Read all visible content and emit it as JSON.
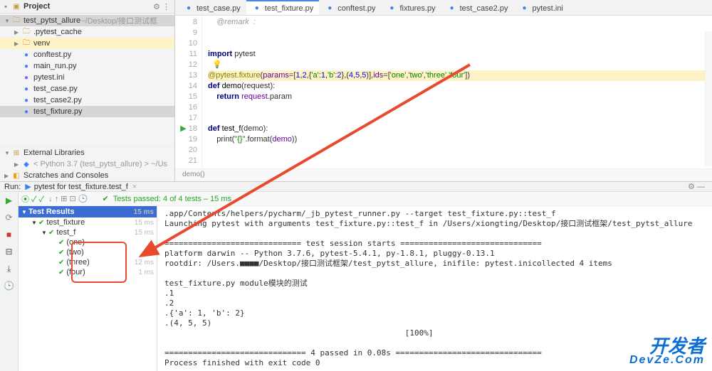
{
  "sidebar": {
    "title": "Project",
    "items": [
      {
        "icon": "folder",
        "name": "test_pytst_allure",
        "suffix": "~/Desktop/接口测试框",
        "cls": "sel",
        "indent": 0,
        "arrow": "▼"
      },
      {
        "icon": "folder",
        "name": ".pytest_cache",
        "cls": "",
        "indent": 1,
        "arrow": "▶"
      },
      {
        "icon": "venv",
        "name": "venv",
        "cls": "hi",
        "indent": 1,
        "arrow": "▶"
      },
      {
        "icon": "py",
        "name": "conftest.py",
        "cls": "",
        "indent": 1,
        "arrow": ""
      },
      {
        "icon": "py",
        "name": "main_run.py",
        "cls": "",
        "indent": 1,
        "arrow": ""
      },
      {
        "icon": "ini",
        "name": "pytest.ini",
        "cls": "",
        "indent": 1,
        "arrow": ""
      },
      {
        "icon": "py",
        "name": "test_case.py",
        "cls": "",
        "indent": 1,
        "arrow": ""
      },
      {
        "icon": "py",
        "name": "test_case2.py",
        "cls": "",
        "indent": 1,
        "arrow": ""
      },
      {
        "icon": "py",
        "name": "test_fixture.py",
        "cls": "sel",
        "indent": 1,
        "arrow": ""
      }
    ],
    "ext_lib": "External Libraries",
    "python_env": "< Python 3.7 (test_pytst_allure) >  ~/Us",
    "scratches": "Scratches and Consoles"
  },
  "tabs": [
    "test_case.py",
    "test_fixture.py",
    "conftest.py",
    "fixtures.py",
    "test_case2.py",
    "pytest.ini"
  ],
  "active_tab": 1,
  "code_start_line": 8,
  "code_lines": [
    {
      "raw": "    @remark  :",
      "parts": [
        [
          "    ",
          "pl"
        ],
        [
          "@remark  :",
          "com"
        ]
      ]
    },
    {
      "raw": "",
      "parts": []
    },
    {
      "raw": "",
      "parts": []
    },
    {
      "raw": "import pytest",
      "parts": [
        [
          "import ",
          "kw"
        ],
        [
          "pytest",
          "pl"
        ]
      ]
    },
    {
      "raw": "  💡",
      "parts": [
        [
          "  💡",
          "pl"
        ]
      ]
    },
    {
      "raw": "@pytest.fixture(params=[1,2,{'a':1,'b':2},(4,5,5)],ids=['one','two','three','four'])",
      "sel": true,
      "parts": [
        [
          "@pytest.fixture",
          "dec"
        ],
        [
          "(",
          "pl"
        ],
        [
          "params",
          "id"
        ],
        [
          "=[",
          "pl"
        ],
        [
          "1",
          "num"
        ],
        [
          ",",
          "pl"
        ],
        [
          "2",
          "num"
        ],
        [
          ",{",
          "pl"
        ],
        [
          "'a'",
          "str"
        ],
        [
          ":",
          "pl"
        ],
        [
          "1",
          "num"
        ],
        [
          ",",
          "pl"
        ],
        [
          "'b'",
          "str"
        ],
        [
          ":",
          "pl"
        ],
        [
          "2",
          "num"
        ],
        [
          "},(",
          "pl"
        ],
        [
          "4",
          "num"
        ],
        [
          ",",
          "pl"
        ],
        [
          "5",
          "num"
        ],
        [
          ",",
          "pl"
        ],
        [
          "5",
          "num"
        ],
        [
          ")],",
          "pl"
        ],
        [
          "ids",
          "id"
        ],
        [
          "=[",
          "pl"
        ],
        [
          "'one'",
          "str"
        ],
        [
          ",",
          "pl"
        ],
        [
          "'two'",
          "str"
        ],
        [
          ",",
          "pl"
        ],
        [
          "'three'",
          "str"
        ],
        [
          ",",
          "pl"
        ],
        [
          "'four'",
          "str"
        ],
        [
          "])",
          "pl"
        ]
      ]
    },
    {
      "raw": "def demo(request):",
      "parts": [
        [
          "def ",
          "kw"
        ],
        [
          "demo",
          "fn"
        ],
        [
          "(request):",
          "pl"
        ]
      ]
    },
    {
      "raw": "    return request.param",
      "parts": [
        [
          "    ",
          "pl"
        ],
        [
          "return ",
          "kw"
        ],
        [
          "request",
          "id"
        ],
        [
          ".param",
          "pl"
        ]
      ]
    },
    {
      "raw": "",
      "parts": []
    },
    {
      "raw": "",
      "parts": []
    },
    {
      "raw": "def test_f(demo):",
      "play": true,
      "parts": [
        [
          "def ",
          "kw"
        ],
        [
          "test_f",
          "fn"
        ],
        [
          "(demo):",
          "pl"
        ]
      ]
    },
    {
      "raw": "    print(\"{}\".format(demo))",
      "parts": [
        [
          "    print(",
          "pl"
        ],
        [
          "\"{}\"",
          "str"
        ],
        [
          ".format(",
          "pl"
        ],
        [
          "demo",
          "id"
        ],
        [
          "))",
          "pl"
        ]
      ]
    },
    {
      "raw": "",
      "parts": []
    },
    {
      "raw": "",
      "parts": []
    }
  ],
  "breadcrumb_text": "demo()",
  "run": {
    "title": "Run:",
    "config": "pytest for test_fixture.test_f",
    "status": "Tests passed: 4 of 4 tests – 15 ms",
    "tree": [
      {
        "label": "Test Results",
        "ms": "15 ms",
        "indent": 0,
        "head": true,
        "arrow": "▼"
      },
      {
        "label": "test_fixture",
        "ms": "15 ms",
        "indent": 1,
        "arrow": "▼"
      },
      {
        "label": "test_f",
        "ms": "15 ms",
        "indent": 2,
        "arrow": "▼"
      },
      {
        "label": "(one)",
        "ms": "",
        "indent": 3,
        "arrow": ""
      },
      {
        "label": "(two)",
        "ms": "",
        "indent": 3,
        "arrow": ""
      },
      {
        "label": "(three)",
        "ms": "12 ms",
        "indent": 3,
        "arrow": ""
      },
      {
        "label": "(four)",
        "ms": "1 ms",
        "indent": 3,
        "arrow": ""
      }
    ],
    "console": ".app/Contents/helpers/pycharm/_jb_pytest_runner.py --target test_fixture.py::test_f\nLaunching pytest with arguments test_fixture.py::test_f in /Users/xiongting/Desktop/接口测试框架/test_pytst_allure\n\n============================= test session starts ==============================\nplatform darwin -- Python 3.7.6, pytest-5.4.1, py-1.8.1, pluggy-0.13.1\nrootdir: /Users.■■■■/Desktop/接口测试框架/test_pytst_allure, inifile: pytest.inicollected 4 items\n\ntest_fixture.py module模块的测试\n.1\n.2\n.{'a': 1, 'b': 2}\n.(4, 5, 5)\n                                                   [100%]\n\n============================== 4 passed in 0.08s ===============================\nProcess finished with exit code 0"
  },
  "watermark": {
    "line1": "开发者",
    "line2": "DevZe.Com"
  }
}
